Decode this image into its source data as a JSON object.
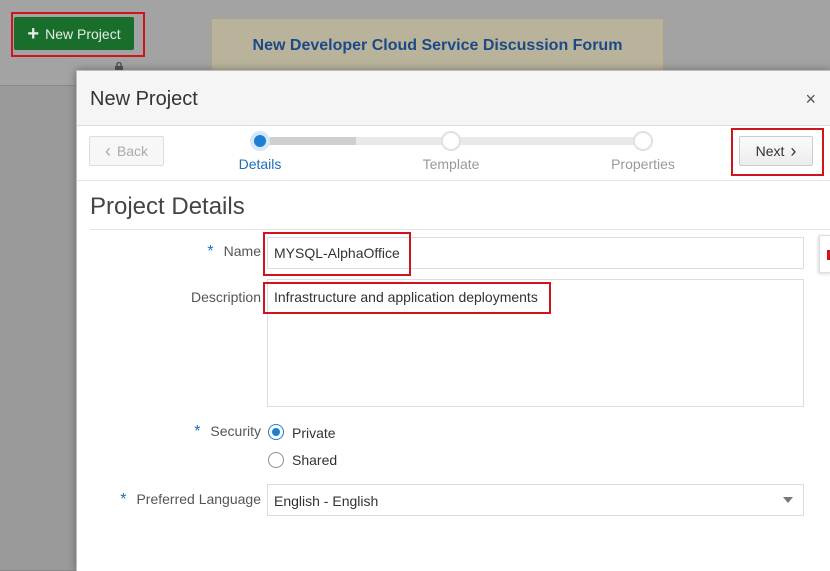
{
  "background": {
    "new_project_label": "New Project",
    "forum_title": "New Developer Cloud Service Discussion Forum"
  },
  "dialog": {
    "title": "New Project",
    "close_glyph": "×",
    "back_label": "Back",
    "next_label": "Next",
    "steps": [
      {
        "label": "Details",
        "state": "current"
      },
      {
        "label": "Template",
        "state": "pending"
      },
      {
        "label": "Properties",
        "state": "pending"
      }
    ],
    "section_title": "Project Details"
  },
  "form": {
    "required_mark": "*",
    "name_label": "Name",
    "name_value": "MYSQL-AlphaOffice",
    "description_label": "Description",
    "description_value": "Infrastructure and application deployments",
    "security_label": "Security",
    "security_options": [
      "Private",
      "Shared"
    ],
    "security_selected": "Private",
    "language_label": "Preferred Language",
    "language_value": "English - English"
  },
  "colors": {
    "accent": "#1c7fd1",
    "highlight": "#d0141c",
    "new_project_green": "#1a6e2c",
    "forum_title": "#1c4a86"
  }
}
